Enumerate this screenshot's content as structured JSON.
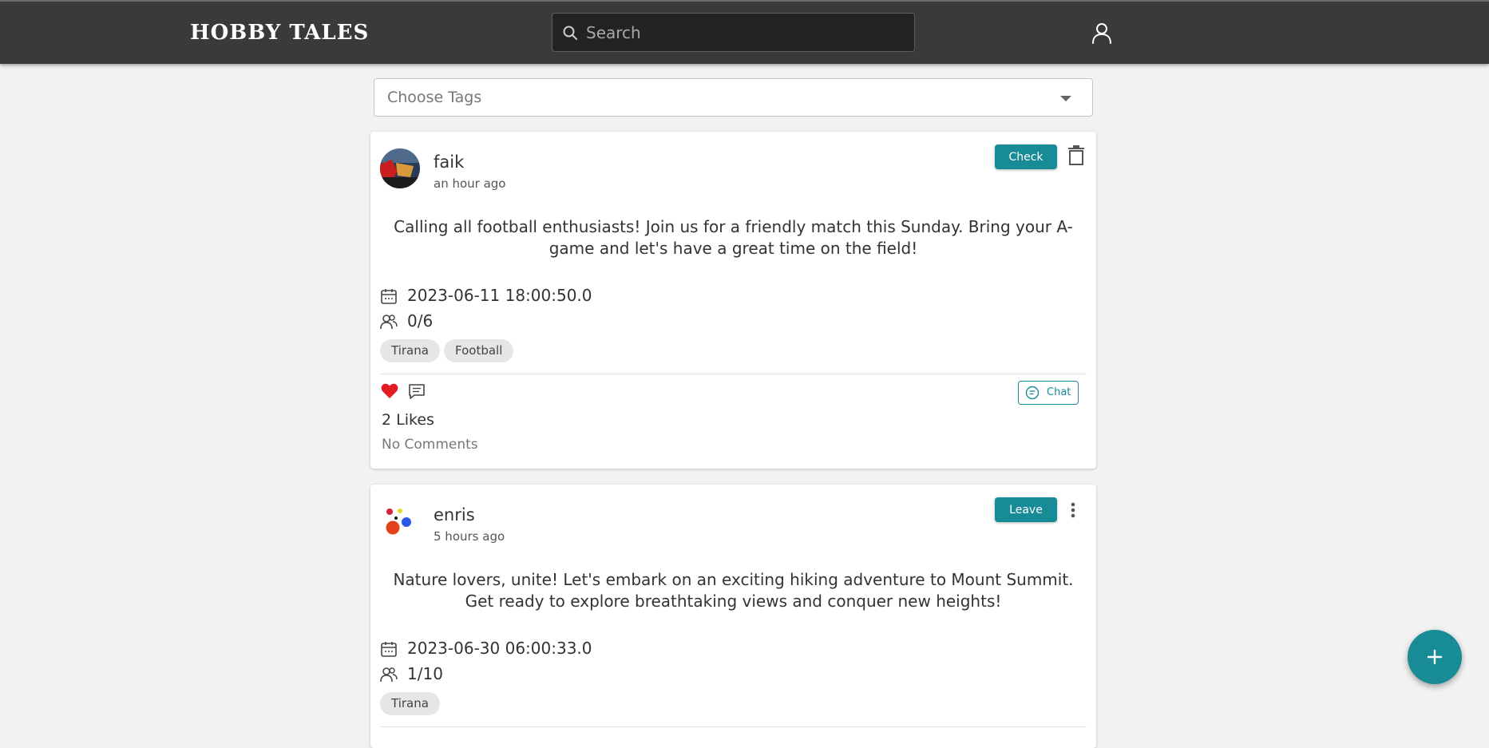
{
  "header": {
    "logo": "HOBBY TALES",
    "search_placeholder": "Search",
    "icons": {
      "search": "search-icon",
      "user": "user-icon"
    }
  },
  "filter": {
    "placeholder": "Choose Tags"
  },
  "colors": {
    "accent": "#178b96",
    "topbar": "#3b3a3a",
    "like": "#e31b23"
  },
  "posts": [
    {
      "user": "faik",
      "time": "an hour ago",
      "action_label": "Check",
      "text": "Calling all football enthusiasts! Join us for a friendly match this Sunday. Bring your A-game and let's have a great time on the field!",
      "date": "2023-06-11 18:00:50.0",
      "participants": "0/6",
      "tags": [
        "Tirana",
        "Football"
      ],
      "liked": true,
      "likes_label": "2 Likes",
      "comments_label": "No Comments",
      "chat_label": "Chat"
    },
    {
      "user": "enris",
      "time": "5 hours ago",
      "action_label": "Leave",
      "text": "Nature lovers, unite! Let's embark on an exciting hiking adventure to Mount Summit. Get ready to explore breathtaking views and conquer new heights!",
      "date": "2023-06-30 06:00:33.0",
      "participants": "1/10",
      "tags": [
        "Tirana"
      ]
    }
  ]
}
